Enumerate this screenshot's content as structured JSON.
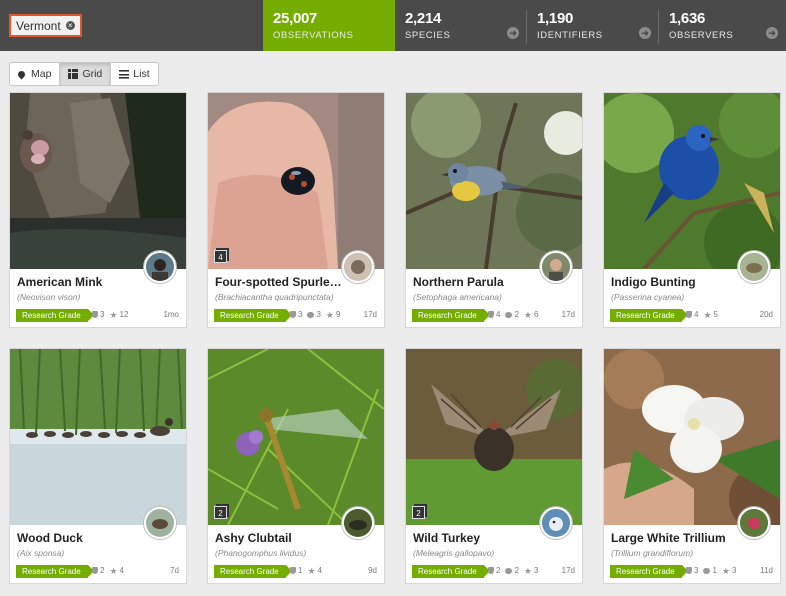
{
  "header": {
    "place": "Vermont",
    "stats": [
      {
        "value": "25,007",
        "label": "OBSERVATIONS",
        "active": true
      },
      {
        "value": "2,214",
        "label": "SPECIES"
      },
      {
        "value": "1,190",
        "label": "IDENTIFIERS"
      },
      {
        "value": "1,636",
        "label": "OBSERVERS"
      }
    ]
  },
  "view": {
    "map": "Map",
    "grid": "Grid",
    "list": "List",
    "selected": "grid"
  },
  "observations": [
    {
      "common": "American Mink",
      "scientific": "(Neovison vison)",
      "grade": "Research Grade",
      "ids": "3",
      "comments": "",
      "faves": "12",
      "ago": "1mo",
      "photos": ""
    },
    {
      "common": "Four-spotted Spurleg La...",
      "scientific": "(Brachiacantha quadripunctata)",
      "grade": "Research Grade",
      "ids": "3",
      "comments": "3",
      "faves": "9",
      "ago": "17d",
      "photos": "4"
    },
    {
      "common": "Northern Parula",
      "scientific": "(Setophaga americana)",
      "grade": "Research Grade",
      "ids": "4",
      "comments": "2",
      "faves": "6",
      "ago": "17d",
      "photos": ""
    },
    {
      "common": "Indigo Bunting",
      "scientific": "(Passerina cyanea)",
      "grade": "Research Grade",
      "ids": "4",
      "comments": "",
      "faves": "5",
      "ago": "20d",
      "photos": ""
    },
    {
      "common": "Wood Duck",
      "scientific": "(Aix sponsa)",
      "grade": "Research Grade",
      "ids": "2",
      "comments": "",
      "faves": "4",
      "ago": "7d",
      "photos": ""
    },
    {
      "common": "Ashy Clubtail",
      "scientific": "(Phanogomphus lividus)",
      "grade": "Research Grade",
      "ids": "1",
      "comments": "",
      "faves": "4",
      "ago": "9d",
      "photos": "2"
    },
    {
      "common": "Wild Turkey",
      "scientific": "(Meleagris gallopavo)",
      "grade": "Research Grade",
      "ids": "2",
      "comments": "2",
      "faves": "3",
      "ago": "17d",
      "photos": "2"
    },
    {
      "common": "Large White Trillium",
      "scientific": "(Trillium grandiflorum)",
      "grade": "Research Grade",
      "ids": "3",
      "comments": "1",
      "faves": "3",
      "ago": "11d",
      "photos": ""
    }
  ]
}
